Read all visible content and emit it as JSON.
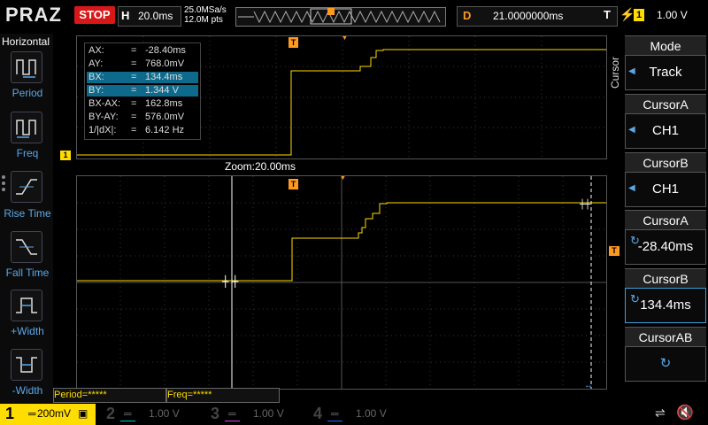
{
  "header": {
    "brand": "PRAZ",
    "run_state": "STOP",
    "timebase_label": "H",
    "timebase_value": "20.0ms",
    "sample_rate": "25.0MSa/s",
    "memory_depth": "12.0M pts",
    "delay_label": "D",
    "delay_value": "21.0000000ms",
    "trigger_label": "T",
    "trigger_channel": "1",
    "trigger_level": "1.00 V"
  },
  "left_panel": {
    "title": "Horizontal",
    "buttons": [
      {
        "label": "Period",
        "icon": "period-icon"
      },
      {
        "label": "Freq",
        "icon": "frequency-icon"
      },
      {
        "label": "Rise Time",
        "icon": "rise-time-icon"
      },
      {
        "label": "Fall Time",
        "icon": "fall-time-icon"
      },
      {
        "label": "+Width",
        "icon": "positive-width-icon"
      },
      {
        "label": "-Width",
        "icon": "negative-width-icon"
      }
    ]
  },
  "cursor_readout": [
    {
      "key": "AX:",
      "value": "-28.40ms",
      "highlight": false
    },
    {
      "key": "AY:",
      "value": "768.0mV",
      "highlight": false
    },
    {
      "key": "BX:",
      "value": "134.4ms",
      "highlight": true
    },
    {
      "key": "BY:",
      "value": "1.344 V",
      "highlight": true
    },
    {
      "key": "BX-AX:",
      "value": "162.8ms",
      "highlight": false
    },
    {
      "key": "BY-AY:",
      "value": "576.0mV",
      "highlight": false
    },
    {
      "key": "1/|dX|:",
      "value": "6.142 Hz",
      "highlight": false
    }
  ],
  "zoom_label": "Zoom:20.00ms",
  "channel_marker": "1",
  "trigger_marker": "T",
  "right_menu": {
    "side_title": "Cursor",
    "items": [
      {
        "title": "Mode",
        "value": "Track"
      },
      {
        "title": "CursorA",
        "value": "CH1"
      },
      {
        "title": "CursorB",
        "value": "CH1"
      },
      {
        "title": "CursorA",
        "value": "-28.40ms"
      },
      {
        "title": "CursorB",
        "value": "134.4ms"
      },
      {
        "title": "CursorAB",
        "value": ""
      }
    ]
  },
  "measurements": {
    "period": "Period=*****",
    "freq": "Freq=*****"
  },
  "channels": [
    {
      "num": "1",
      "scale": "200mV",
      "color": "#ffdd00"
    },
    {
      "num": "2",
      "scale": "1.00 V",
      "color": "#00c8c8"
    },
    {
      "num": "3",
      "scale": "1.00 V",
      "color": "#e040e0"
    },
    {
      "num": "4",
      "scale": "1.00 V",
      "color": "#1e6eff"
    }
  ],
  "colors": {
    "ch1": "#ffdd00",
    "accent": "#5aa8e8",
    "trigger": "#ff9a1e",
    "stop": "#d81818"
  }
}
